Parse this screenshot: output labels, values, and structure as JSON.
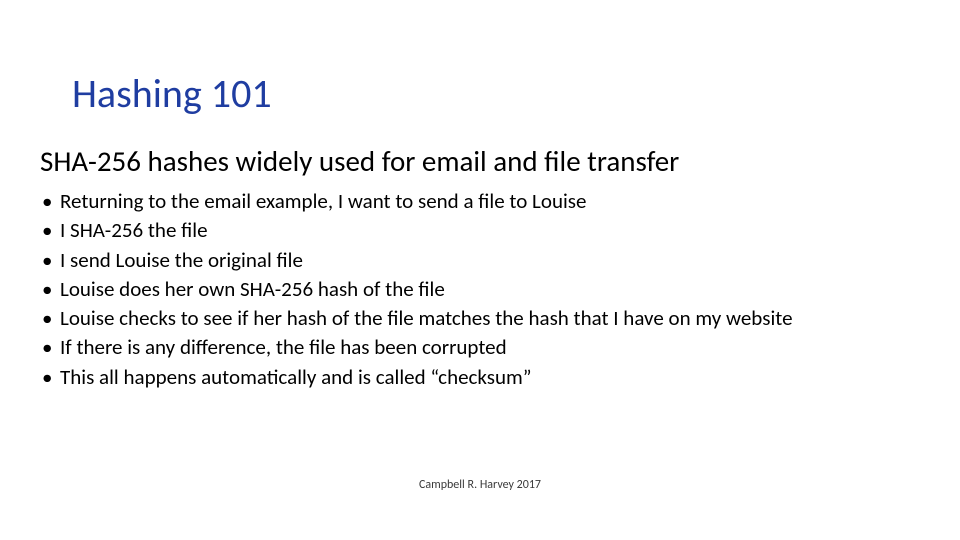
{
  "title": "Hashing 101",
  "subtitle": "SHA-256 hashes widely used for email and file transfer",
  "bullets": [
    "Returning to the email example, I want to send a file to Louise",
    "I SHA-256 the file",
    "I send Louise the original file",
    "Louise does her own SHA-256 hash of the file",
    "Louise checks to see if her hash of the file matches the hash that I have on my website",
    "If there is any difference, the file has been corrupted",
    "This all happens automatically and is called “checksum”"
  ],
  "footer": "Campbell R. Harvey 2017"
}
